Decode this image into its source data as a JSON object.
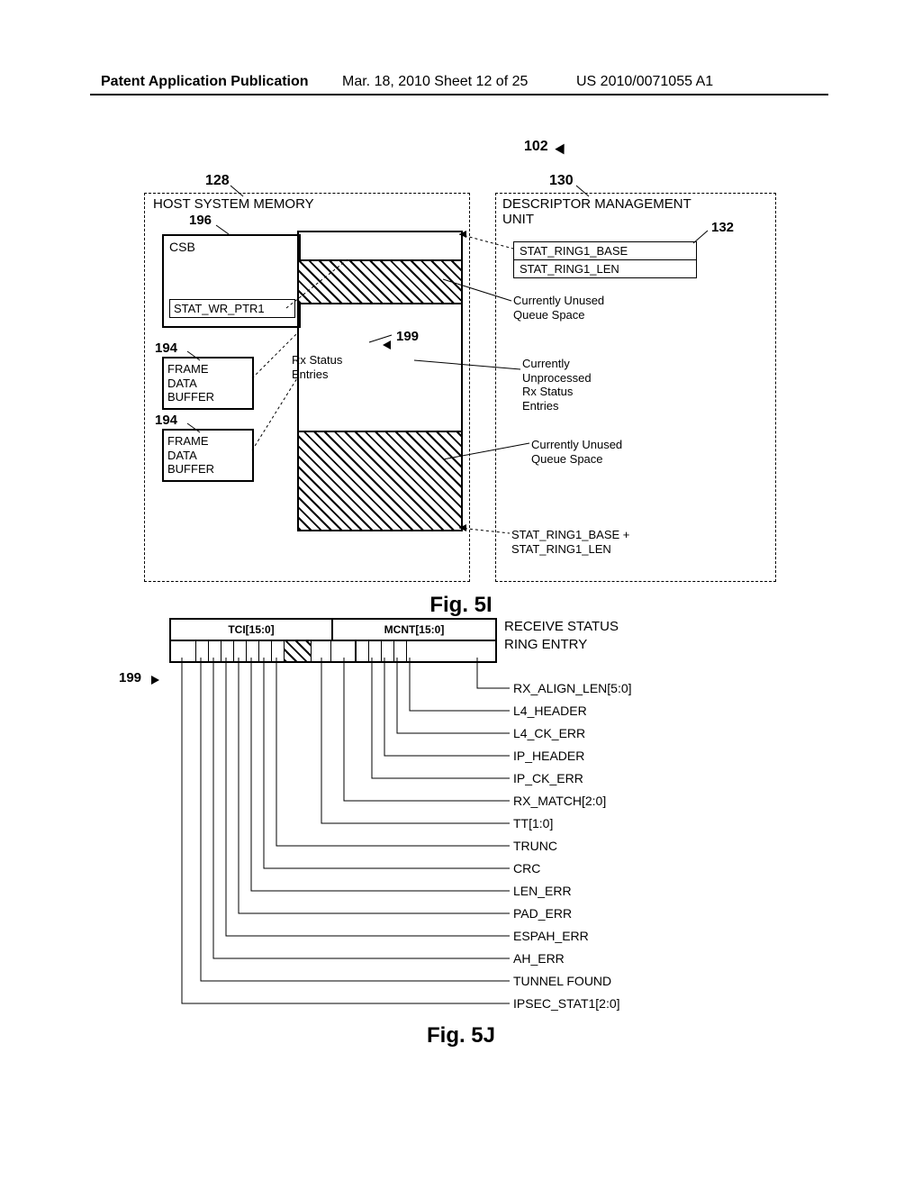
{
  "header": {
    "left": "Patent Application Publication",
    "mid": "Mar. 18, 2010  Sheet 12 of 25",
    "right": "US 2010/0071055 A1"
  },
  "fig5i": {
    "ref_102": "102",
    "ref_128": "128",
    "ref_130": "130",
    "host_title": "HOST SYSTEM MEMORY",
    "ref_196": "196",
    "dmu_title_l1": "DESCRIPTOR MANAGEMENT",
    "dmu_title_l2": "UNIT",
    "ref_132": "132",
    "csb": "CSB",
    "stat_wr": "STAT_WR_PTR1",
    "ref_194": "194",
    "frame_buf_l1": "FRAME",
    "frame_buf_l2": "DATA",
    "frame_buf_l3": "BUFFER",
    "rx_entries_l1": "Rx Status",
    "rx_entries_l2": "Entries",
    "reg_base": "STAT_RING1_BASE",
    "reg_len": "STAT_RING1_LEN",
    "unused_l1": "Currently Unused",
    "unused_l2": "Queue Space",
    "unproc_l1": "Currently",
    "unproc_l2": "Unprocessed",
    "unproc_l3": "Rx Status",
    "unproc_l4": "Entries",
    "unused2_l1": "Currently Unused",
    "unused2_l2": "Queue Space",
    "ring_calc_l1": "STAT_RING1_BASE +",
    "ring_calc_l2": "STAT_RING1_LEN",
    "ref_199": "199",
    "label": "Fig. 5I"
  },
  "fig5j": {
    "ref_199": "199",
    "tci": "TCI[15:0]",
    "mcnt": "MCNT[15:0]",
    "rse_l1": "RECEIVE STATUS",
    "rse_l2": "RING ENTRY",
    "fields": [
      "RX_ALIGN_LEN[5:0]",
      "L4_HEADER",
      "L4_CK_ERR",
      "IP_HEADER",
      "IP_CK_ERR",
      "RX_MATCH[2:0]",
      "TT[1:0]",
      "TRUNC",
      "CRC",
      "LEN_ERR",
      "PAD_ERR",
      "ESPAH_ERR",
      "AH_ERR",
      "TUNNEL FOUND",
      "IPSEC_STAT1[2:0]"
    ],
    "label": "Fig. 5J"
  },
  "chart_data": [
    {
      "type": "diagram",
      "title": "Fig. 5I - Host memory ring buffer and Descriptor Management Unit",
      "host_system_memory": {
        "ref": 128,
        "CSB": {
          "ref": 196,
          "contains": "STAT_WR_PTR1"
        },
        "frame_data_buffers": [
          {
            "ref": 194
          },
          {
            "ref": 194
          }
        ],
        "ring_buffer": {
          "ref": 199,
          "regions": [
            "Currently Unused Queue Space (hatched)",
            "Rx Status Entries (Currently Unprocessed Rx Status Entries)",
            "Currently Unused Queue Space (hatched)"
          ],
          "bounds": {
            "start": "STAT_RING1_BASE",
            "end": "STAT_RING1_BASE + STAT_RING1_LEN"
          }
        }
      },
      "descriptor_management_unit": {
        "ref": 130,
        "registers_ref": 132,
        "registers": [
          "STAT_RING1_BASE",
          "STAT_RING1_LEN"
        ]
      },
      "overall_ref": 102
    },
    {
      "type": "diagram",
      "title": "Fig. 5J - Receive Status Ring Entry bit layout",
      "ref": 199,
      "word0": {
        "upper_half": "TCI[15:0]",
        "lower_half": "MCNT[15:0]"
      },
      "word1_bitfields_left_to_right": [
        "IPSEC_STAT1[2:0]",
        "TUNNEL FOUND",
        "AH_ERR",
        "ESPAH_ERR",
        "PAD_ERR",
        "LEN_ERR",
        "CRC",
        "TRUNC",
        "reserved(hatched)",
        "TT[1:0]",
        "RX_MATCH[2:0]",
        "IP_CK_ERR",
        "IP_HEADER",
        "L4_CK_ERR",
        "L4_HEADER",
        "RX_ALIGN_LEN[5:0]"
      ]
    }
  ]
}
